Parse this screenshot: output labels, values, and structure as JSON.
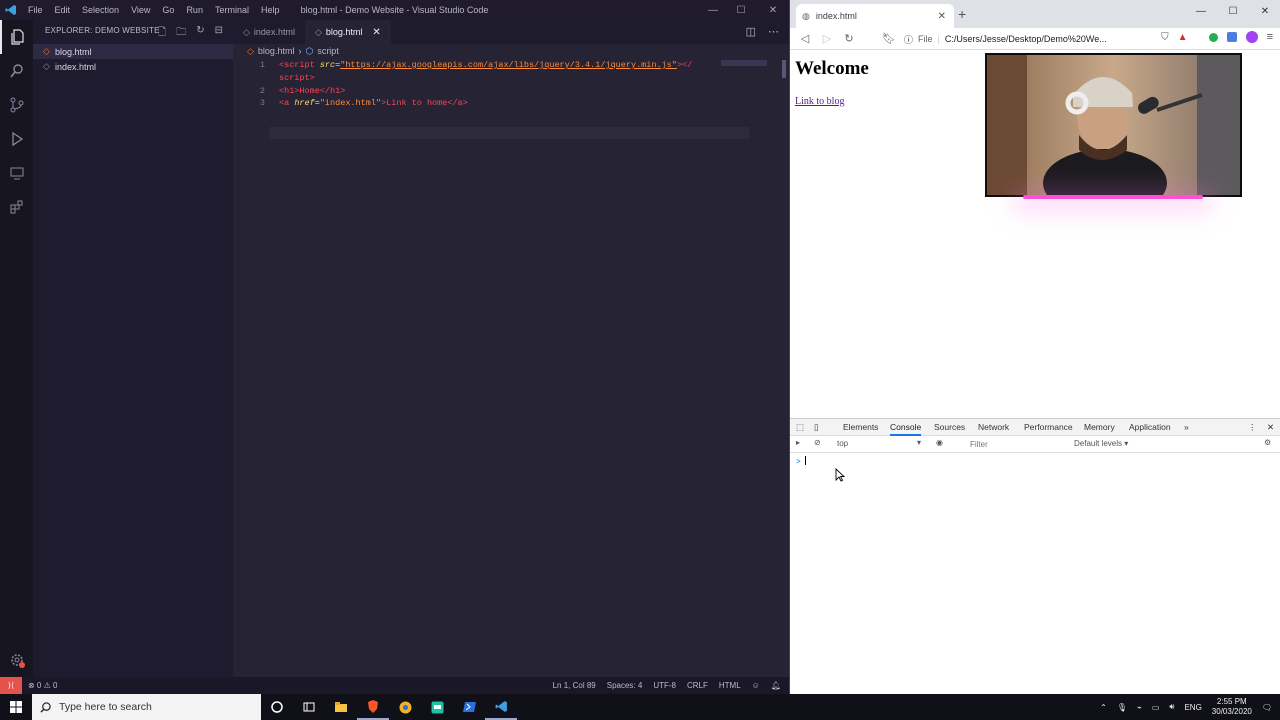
{
  "vscode": {
    "menu": [
      "File",
      "Edit",
      "Selection",
      "View",
      "Go",
      "Run",
      "Terminal",
      "Help"
    ],
    "window_title": "blog.html - Demo Website - Visual Studio Code",
    "explorer_header": "EXPLORER: DEMO WEBSITE",
    "files": [
      "blog.html",
      "index.html"
    ],
    "tabs": [
      "index.html",
      "blog.html"
    ],
    "breadcrumb": {
      "file": "blog.html",
      "symbol": "script"
    },
    "code": {
      "line_numbers": [
        "1",
        "2",
        "3"
      ],
      "l1_open": "<script ",
      "l1_attr": "src=",
      "l1_str": "\"https://ajax.googleapis.com/ajax/libs/jquery/3.4.1/jquery.min.js\"",
      "l1_close": "></",
      "l1_wrap": "script>",
      "l2": "<h1>Home</h1>",
      "l3_open": "<a ",
      "l3_attr": "href=",
      "l3_str": "\"index.html\"",
      "l3_rest": ">Link to home</a>"
    },
    "status": {
      "problems": "⊗ 0 ⚠ 0",
      "position": "Ln 1, Col 89",
      "spaces": "Spaces: 4",
      "encoding": "UTF-8",
      "eol": "CRLF",
      "language": "HTML"
    }
  },
  "browser": {
    "tab_title": "index.html",
    "address_label": "File",
    "address": "C:/Users/Jesse/Desktop/Demo%20We...",
    "page": {
      "heading": "Welcome",
      "link": "Link to blog"
    },
    "devtools": {
      "tabs": [
        "Elements",
        "Console",
        "Sources",
        "Network",
        "Performance",
        "Memory",
        "Application"
      ],
      "active_tab": "Console",
      "context": "top",
      "filter_placeholder": "Filter",
      "levels": "Default levels ▾",
      "prompt": ">"
    }
  },
  "taskbar": {
    "search_placeholder": "Type here to search",
    "language": "ENG",
    "time": "2:55 PM",
    "date": "30/03/2020"
  },
  "colors": {
    "accent": "#1a73e8",
    "vscode_bg": "#262335",
    "link_visited": "#551a8b"
  }
}
